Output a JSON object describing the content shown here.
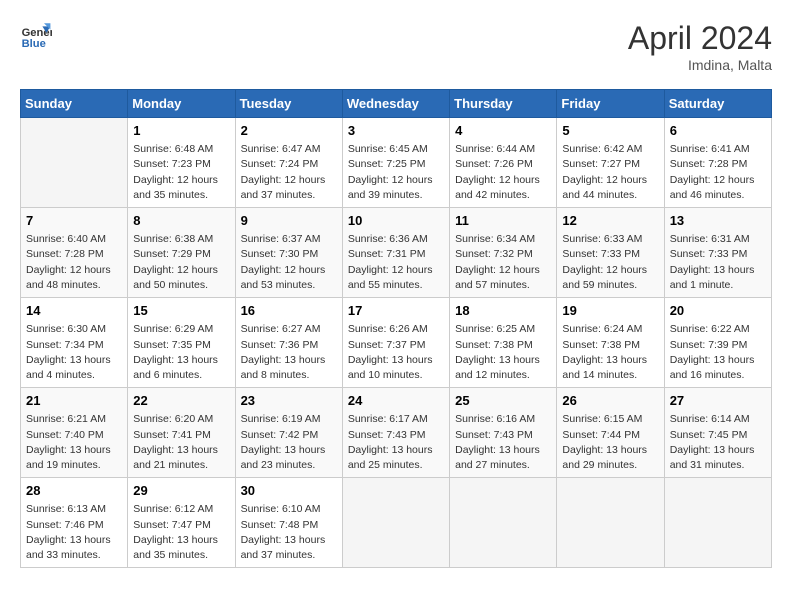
{
  "header": {
    "logo_line1": "General",
    "logo_line2": "Blue",
    "title": "April 2024",
    "subtitle": "Imdina, Malta"
  },
  "weekdays": [
    "Sunday",
    "Monday",
    "Tuesday",
    "Wednesday",
    "Thursday",
    "Friday",
    "Saturday"
  ],
  "weeks": [
    [
      {
        "day": "",
        "info": ""
      },
      {
        "day": "1",
        "info": "Sunrise: 6:48 AM\nSunset: 7:23 PM\nDaylight: 12 hours\nand 35 minutes."
      },
      {
        "day": "2",
        "info": "Sunrise: 6:47 AM\nSunset: 7:24 PM\nDaylight: 12 hours\nand 37 minutes."
      },
      {
        "day": "3",
        "info": "Sunrise: 6:45 AM\nSunset: 7:25 PM\nDaylight: 12 hours\nand 39 minutes."
      },
      {
        "day": "4",
        "info": "Sunrise: 6:44 AM\nSunset: 7:26 PM\nDaylight: 12 hours\nand 42 minutes."
      },
      {
        "day": "5",
        "info": "Sunrise: 6:42 AM\nSunset: 7:27 PM\nDaylight: 12 hours\nand 44 minutes."
      },
      {
        "day": "6",
        "info": "Sunrise: 6:41 AM\nSunset: 7:28 PM\nDaylight: 12 hours\nand 46 minutes."
      }
    ],
    [
      {
        "day": "7",
        "info": "Sunrise: 6:40 AM\nSunset: 7:28 PM\nDaylight: 12 hours\nand 48 minutes."
      },
      {
        "day": "8",
        "info": "Sunrise: 6:38 AM\nSunset: 7:29 PM\nDaylight: 12 hours\nand 50 minutes."
      },
      {
        "day": "9",
        "info": "Sunrise: 6:37 AM\nSunset: 7:30 PM\nDaylight: 12 hours\nand 53 minutes."
      },
      {
        "day": "10",
        "info": "Sunrise: 6:36 AM\nSunset: 7:31 PM\nDaylight: 12 hours\nand 55 minutes."
      },
      {
        "day": "11",
        "info": "Sunrise: 6:34 AM\nSunset: 7:32 PM\nDaylight: 12 hours\nand 57 minutes."
      },
      {
        "day": "12",
        "info": "Sunrise: 6:33 AM\nSunset: 7:33 PM\nDaylight: 12 hours\nand 59 minutes."
      },
      {
        "day": "13",
        "info": "Sunrise: 6:31 AM\nSunset: 7:33 PM\nDaylight: 13 hours\nand 1 minute."
      }
    ],
    [
      {
        "day": "14",
        "info": "Sunrise: 6:30 AM\nSunset: 7:34 PM\nDaylight: 13 hours\nand 4 minutes."
      },
      {
        "day": "15",
        "info": "Sunrise: 6:29 AM\nSunset: 7:35 PM\nDaylight: 13 hours\nand 6 minutes."
      },
      {
        "day": "16",
        "info": "Sunrise: 6:27 AM\nSunset: 7:36 PM\nDaylight: 13 hours\nand 8 minutes."
      },
      {
        "day": "17",
        "info": "Sunrise: 6:26 AM\nSunset: 7:37 PM\nDaylight: 13 hours\nand 10 minutes."
      },
      {
        "day": "18",
        "info": "Sunrise: 6:25 AM\nSunset: 7:38 PM\nDaylight: 13 hours\nand 12 minutes."
      },
      {
        "day": "19",
        "info": "Sunrise: 6:24 AM\nSunset: 7:38 PM\nDaylight: 13 hours\nand 14 minutes."
      },
      {
        "day": "20",
        "info": "Sunrise: 6:22 AM\nSunset: 7:39 PM\nDaylight: 13 hours\nand 16 minutes."
      }
    ],
    [
      {
        "day": "21",
        "info": "Sunrise: 6:21 AM\nSunset: 7:40 PM\nDaylight: 13 hours\nand 19 minutes."
      },
      {
        "day": "22",
        "info": "Sunrise: 6:20 AM\nSunset: 7:41 PM\nDaylight: 13 hours\nand 21 minutes."
      },
      {
        "day": "23",
        "info": "Sunrise: 6:19 AM\nSunset: 7:42 PM\nDaylight: 13 hours\nand 23 minutes."
      },
      {
        "day": "24",
        "info": "Sunrise: 6:17 AM\nSunset: 7:43 PM\nDaylight: 13 hours\nand 25 minutes."
      },
      {
        "day": "25",
        "info": "Sunrise: 6:16 AM\nSunset: 7:43 PM\nDaylight: 13 hours\nand 27 minutes."
      },
      {
        "day": "26",
        "info": "Sunrise: 6:15 AM\nSunset: 7:44 PM\nDaylight: 13 hours\nand 29 minutes."
      },
      {
        "day": "27",
        "info": "Sunrise: 6:14 AM\nSunset: 7:45 PM\nDaylight: 13 hours\nand 31 minutes."
      }
    ],
    [
      {
        "day": "28",
        "info": "Sunrise: 6:13 AM\nSunset: 7:46 PM\nDaylight: 13 hours\nand 33 minutes."
      },
      {
        "day": "29",
        "info": "Sunrise: 6:12 AM\nSunset: 7:47 PM\nDaylight: 13 hours\nand 35 minutes."
      },
      {
        "day": "30",
        "info": "Sunrise: 6:10 AM\nSunset: 7:48 PM\nDaylight: 13 hours\nand 37 minutes."
      },
      {
        "day": "",
        "info": ""
      },
      {
        "day": "",
        "info": ""
      },
      {
        "day": "",
        "info": ""
      },
      {
        "day": "",
        "info": ""
      }
    ]
  ]
}
